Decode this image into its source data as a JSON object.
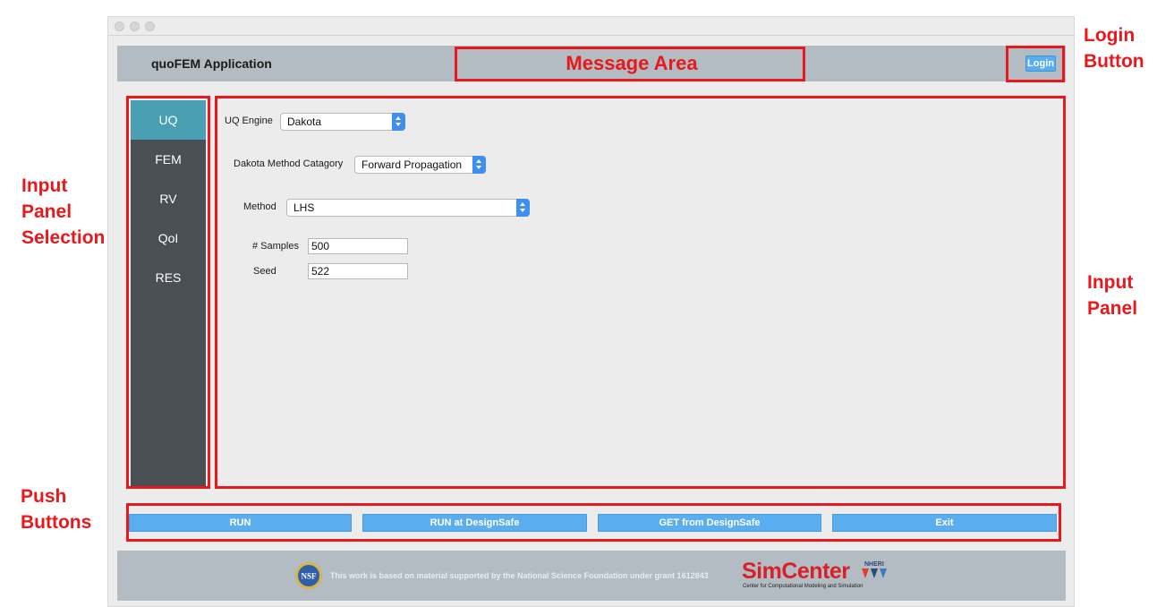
{
  "window": {
    "app_title": "quoFEM Application",
    "message_area": "Message Area",
    "login_label": "Login"
  },
  "sidebar": {
    "items": [
      {
        "label": "UQ",
        "active": true
      },
      {
        "label": "FEM",
        "active": false
      },
      {
        "label": "RV",
        "active": false
      },
      {
        "label": "QoI",
        "active": false
      },
      {
        "label": "RES",
        "active": false
      }
    ]
  },
  "uq_panel": {
    "engine_label": "UQ Engine",
    "engine_value": "Dakota",
    "category_label": "Dakota Method Catagory",
    "category_value": "Forward Propagation",
    "method_label": "Method",
    "method_value": "LHS",
    "samples_label": "# Samples",
    "samples_value": "500",
    "seed_label": "Seed",
    "seed_value": "522"
  },
  "push_buttons": {
    "run": "RUN",
    "run_designsafe": "RUN at DesignSafe",
    "get_designsafe": "GET from DesignSafe",
    "exit": "Exit"
  },
  "footer": {
    "nsf_logo": "NSF",
    "grant_text": "This work is based on material supported by the National Science Foundation under grant 1612843",
    "simcenter": "SimCenter",
    "nheri": "NHERI",
    "simcenter_subtitle": "Center for Computational Modeling and Simulation"
  },
  "annotations": {
    "login_button": [
      "Login",
      "Button"
    ],
    "input_panel_selection": [
      "Input",
      "Panel",
      "Selection"
    ],
    "input_panel": [
      "Input",
      "Panel"
    ],
    "push_buttons": [
      "Push",
      "Buttons"
    ]
  },
  "colors": {
    "annotation_red": "#e8191c",
    "header_gray": "#b3bcc2",
    "sidebar_dark": "#4a4f55",
    "sidebar_active": "#4a9fb2",
    "button_blue": "#5aaef0"
  }
}
